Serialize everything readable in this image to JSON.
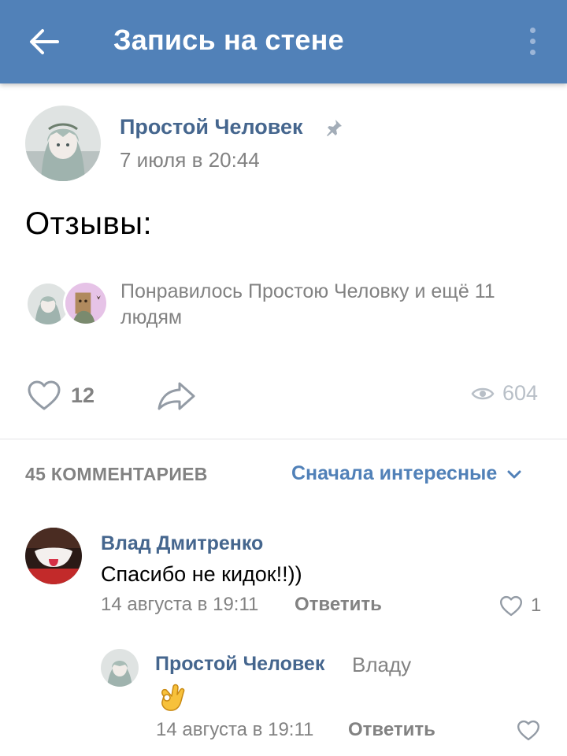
{
  "appbar": {
    "title": "Запись на стене",
    "back_icon": "arrow-left-icon",
    "menu_icon": "more-vertical-icon"
  },
  "post": {
    "author": "Простой Человек",
    "time": "7 июля в 20:44",
    "text": "Отзывы:",
    "pinned_icon": "pin-icon",
    "likes_text": "Понравилось Простою Человку и ещё 11 людям",
    "like_count": "12",
    "views": "604"
  },
  "comments": {
    "count_label": "45 КОММЕНТАРИЕВ",
    "sort_label": "Сначала интересные",
    "items": [
      {
        "author": "Влад Дмитренко",
        "text": "Спасибо не кидок!!))",
        "time": "14 августа в 19:11",
        "reply_label": "Ответить",
        "likes": "1"
      },
      {
        "author": "Простой Человек",
        "reply_to": "Владу",
        "text": "👌",
        "time": "14 августа в 19:11",
        "reply_label": "Ответить",
        "likes": ""
      }
    ]
  },
  "colors": {
    "header": "#5181b8",
    "link": "#45668e",
    "accent": "#5181b8",
    "secondary_text": "#828282"
  }
}
